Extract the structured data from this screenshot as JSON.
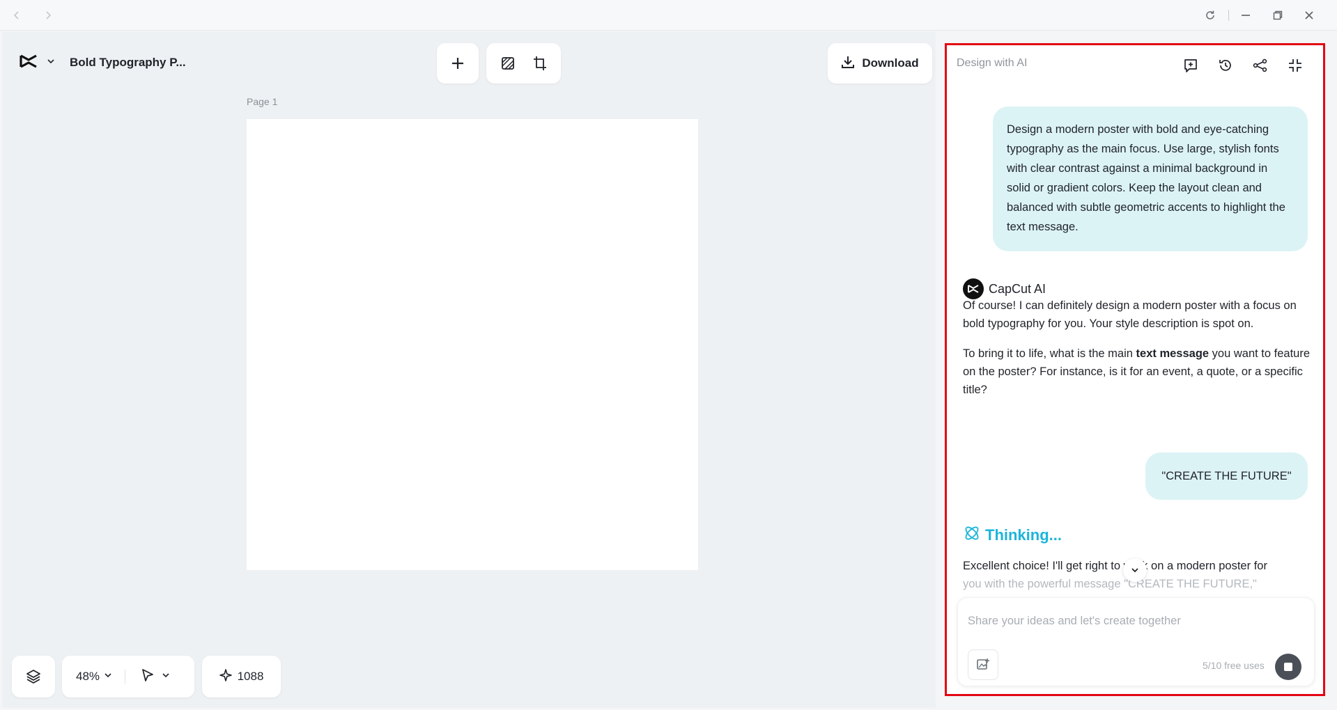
{
  "project": {
    "title": "Bold Typography P..."
  },
  "toolbar": {
    "download_label": "Download"
  },
  "canvas": {
    "page_label": "Page 1"
  },
  "bottom_bar": {
    "zoom": "48%",
    "credits": "1088"
  },
  "ai_panel": {
    "title": "Design with AI",
    "user_message_1": "Design a modern poster with bold and eye-catching typography as the main focus. Use large, stylish fonts with clear contrast against a minimal background in solid or gradient colors. Keep the layout clean and balanced with subtle geometric accents to highlight the text message.",
    "assistant_name": "CapCut AI",
    "assistant_p1": "Of course! I can definitely design a modern poster with a focus on bold typography for you. Your style description is spot on.",
    "assistant_p2_before": "To bring it to life, what is the main ",
    "assistant_p2_bold": "text message",
    "assistant_p2_after": " you want to feature on the poster? For instance, is it for an event, a quote, or a specific title?",
    "user_message_2": "\"CREATE THE FUTURE\"",
    "thinking_label": "Thinking...",
    "streaming_line_1": "Excellent choice! I'll get right to work on a modern poster for",
    "streaming_line_2": "you with the powerful message \"CREATE THE FUTURE,\"",
    "input_placeholder": "Share your ideas and let's create together",
    "free_uses": "5/10 free uses"
  },
  "colors": {
    "accent": "#1cb5d9",
    "panel_highlight": "#e30613",
    "user_bubble": "#dcf3f5"
  }
}
